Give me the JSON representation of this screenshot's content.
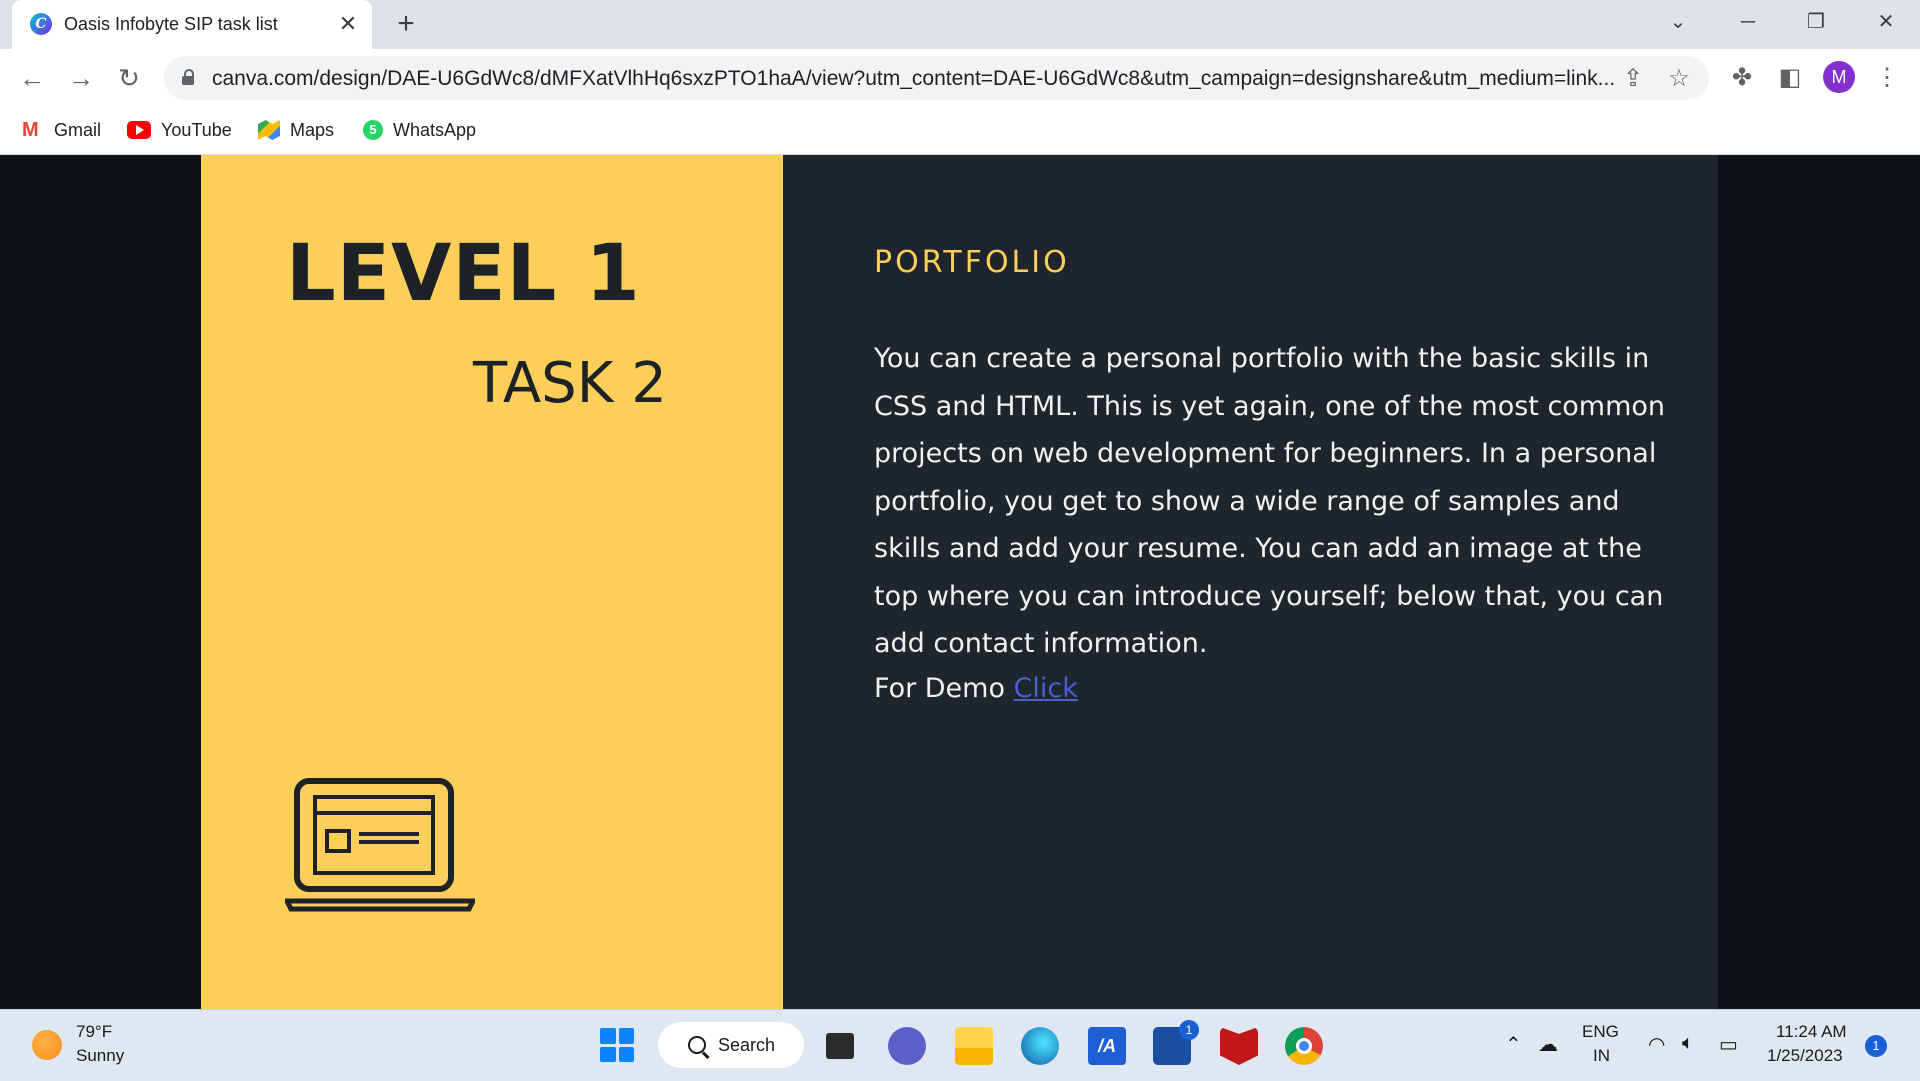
{
  "browser": {
    "tab_title": "Oasis Infobyte SIP task list",
    "url": "canva.com/design/DAE-U6GdWc8/dMFXatVlhHq6sxzPTO1haA/view?utm_content=DAE-U6GdWc8&utm_campaign=designshare&utm_medium=link...",
    "profile_initial": "M",
    "bookmarks": [
      {
        "label": "Gmail",
        "icon": "gmail-icon"
      },
      {
        "label": "YouTube",
        "icon": "youtube-icon"
      },
      {
        "label": "Maps",
        "icon": "maps-icon"
      },
      {
        "label": "WhatsApp",
        "icon": "whatsapp-icon"
      }
    ]
  },
  "slide": {
    "level": "LEVEL 1",
    "task": "TASK 2",
    "heading": "PORTFOLIO",
    "description": "You can create a personal portfolio with the basic skills in CSS and HTML. This is yet again, one of the most common projects on web development for beginners. In a personal portfolio, you get to show a wide range of samples and skills and add your resume. You can add an image at the top where you can introduce yourself; below that, you can add contact information.",
    "demo_prefix": "For Demo ",
    "demo_link": "Click",
    "colors": {
      "accent": "#fccf5a",
      "panel": "#1e252c",
      "link": "#4a5fd1"
    }
  },
  "taskbar": {
    "weather_temp": "79°F",
    "weather_condition": "Sunny",
    "search_label": "Search",
    "store_badge": "1",
    "language_line1": "ENG",
    "language_line2": "IN",
    "time": "11:24 AM",
    "date": "1/25/2023",
    "notification_count": "1"
  }
}
